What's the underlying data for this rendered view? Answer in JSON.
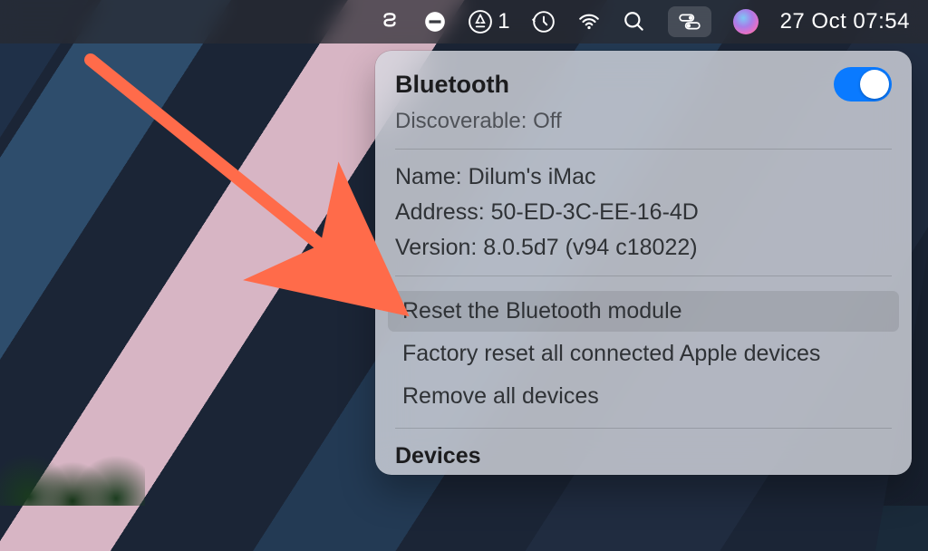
{
  "menubar": {
    "appstore_badge": "1",
    "clock": "27 Oct  07:54"
  },
  "panel": {
    "title": "Bluetooth",
    "toggle_on": true,
    "discoverable_label": "Discoverable:",
    "discoverable_value": "Off",
    "info": {
      "name_label": "Name:",
      "name_value": "Dilum's iMac",
      "address_label": "Address:",
      "address_value": "50-ED-3C-EE-16-4D",
      "version_label": "Version:",
      "version_value": "8.0.5d7 (v94 c18022)"
    },
    "actions": {
      "reset_module": "Reset the Bluetooth module",
      "factory_reset": "Factory reset all connected Apple devices",
      "remove_all": "Remove all devices"
    },
    "devices_section": "Devices"
  },
  "annotation": {
    "arrow_color": "#ff6b4a"
  }
}
